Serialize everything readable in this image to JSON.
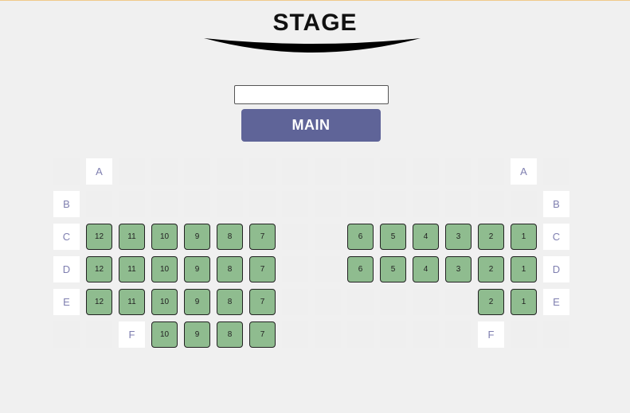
{
  "stage": {
    "title": "STAGE"
  },
  "search": {
    "value": "",
    "placeholder": ""
  },
  "main_button": {
    "label": "MAIN"
  },
  "colors": {
    "seat": "#8fbc8f",
    "button": "#5f6498",
    "row_label": "#7f7fb0"
  },
  "grid": {
    "rows": [
      {
        "row": "A",
        "cells": [
          "",
          "A",
          "",
          "",
          "",
          "",
          "",
          "",
          "",
          "",
          "",
          "",
          "",
          "",
          "A",
          ""
        ]
      },
      {
        "row": "B",
        "cells": [
          "B",
          "",
          "",
          "",
          "",
          "",
          "",
          "",
          "",
          "",
          "",
          "",
          "",
          "",
          "",
          "B"
        ]
      },
      {
        "row": "C",
        "cells": [
          "C",
          "12",
          "11",
          "10",
          "9",
          "8",
          "7",
          "",
          "",
          "6",
          "5",
          "4",
          "3",
          "2",
          "1",
          "C"
        ]
      },
      {
        "row": "D",
        "cells": [
          "D",
          "12",
          "11",
          "10",
          "9",
          "8",
          "7",
          "",
          "",
          "6",
          "5",
          "4",
          "3",
          "2",
          "1",
          "D"
        ]
      },
      {
        "row": "E",
        "cells": [
          "E",
          "12",
          "11",
          "10",
          "9",
          "8",
          "7",
          "",
          "",
          "",
          "",
          "",
          "",
          "2",
          "1",
          "E"
        ]
      },
      {
        "row": "F",
        "cells": [
          "",
          "",
          "F",
          "10",
          "9",
          "8",
          "7",
          "",
          "",
          "",
          "",
          "",
          "",
          "F",
          "",
          ""
        ]
      }
    ]
  }
}
